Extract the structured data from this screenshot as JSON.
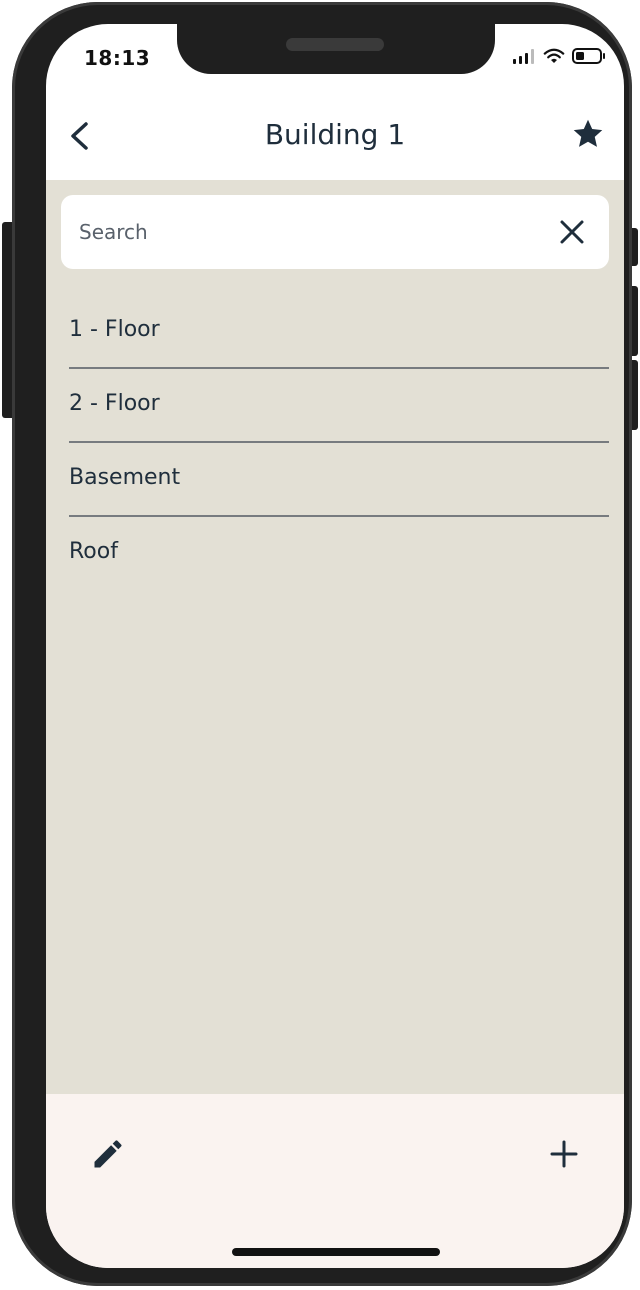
{
  "status": {
    "time": "18:13"
  },
  "header": {
    "title": "Building 1"
  },
  "search": {
    "placeholder": "Search",
    "value": ""
  },
  "items": [
    {
      "label": "1 - Floor"
    },
    {
      "label": "2 - Floor"
    },
    {
      "label": "Basement"
    },
    {
      "label": "Roof"
    }
  ],
  "icons": {
    "back": "chevron-left-icon",
    "favorite": "star-icon",
    "clear": "close-icon",
    "edit": "pencil-icon",
    "add": "plus-icon"
  },
  "colors": {
    "content_background": "#e3e0d5",
    "bottom_bar": "#faf3f0",
    "text_primary": "#1f2e3c"
  }
}
